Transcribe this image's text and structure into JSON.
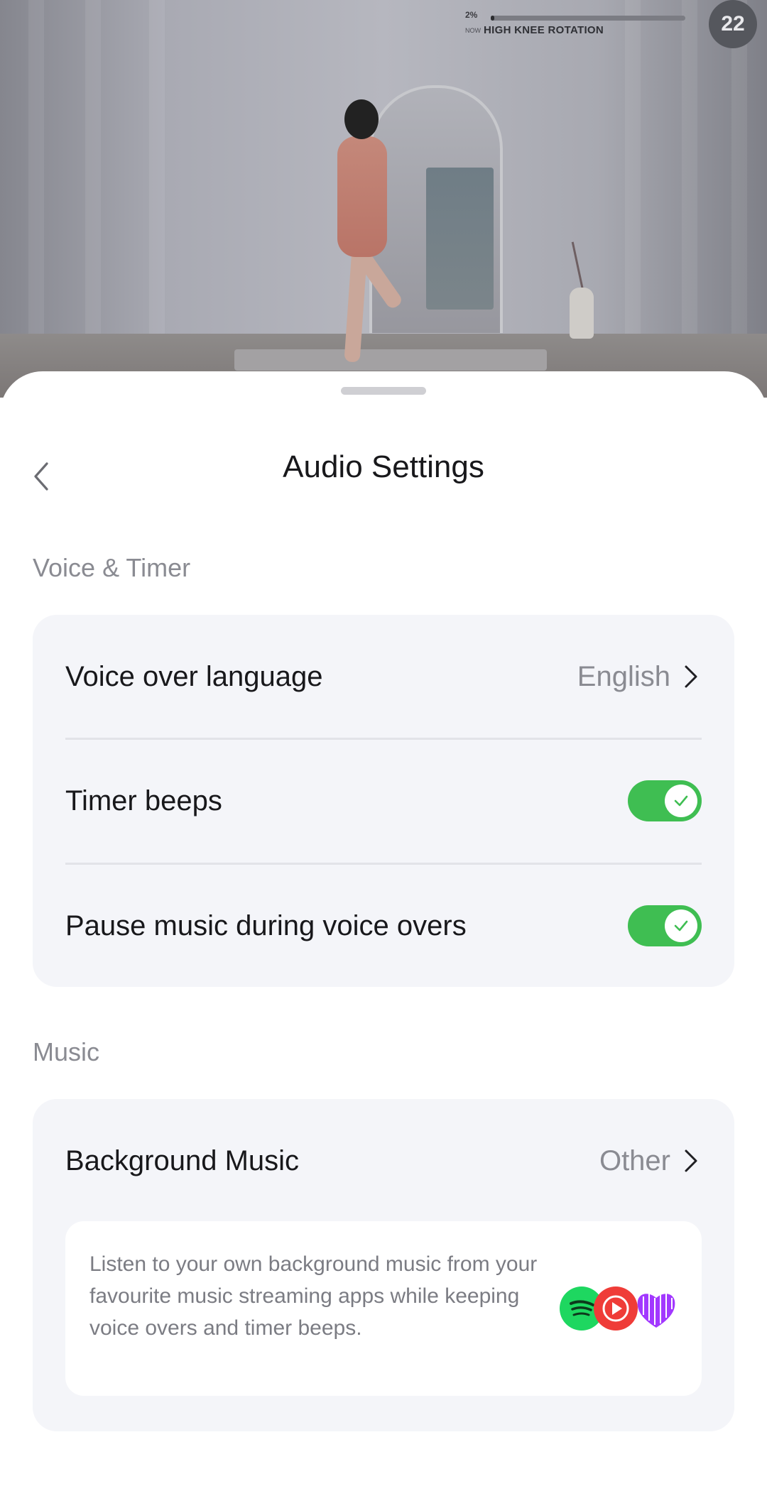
{
  "player": {
    "progress_percent": 2,
    "progress_label": "2%",
    "now_label": "NOW",
    "exercise": "HIGH KNEE ROTATION",
    "count": "22"
  },
  "sheet": {
    "title": "Audio Settings",
    "sections": {
      "voice_timer": {
        "label": "Voice & Timer",
        "voice_language": {
          "label": "Voice over language",
          "value": "English"
        },
        "timer_beeps": {
          "label": "Timer beeps",
          "enabled": true
        },
        "pause_music": {
          "label": "Pause music during voice overs",
          "enabled": true
        }
      },
      "music": {
        "label": "Music",
        "background_music": {
          "label": "Background Music",
          "value": "Other"
        },
        "info_text": "Listen to your own background music from your favourite music streaming apps while keeping voice overs and timer beeps.",
        "apps": [
          "spotify-icon",
          "youtube-music-icon",
          "deezer-icon"
        ]
      }
    }
  },
  "colors": {
    "toggle_on": "#3fbe52",
    "card_bg": "#f4f5f9",
    "secondary_text": "#8a8b92"
  }
}
